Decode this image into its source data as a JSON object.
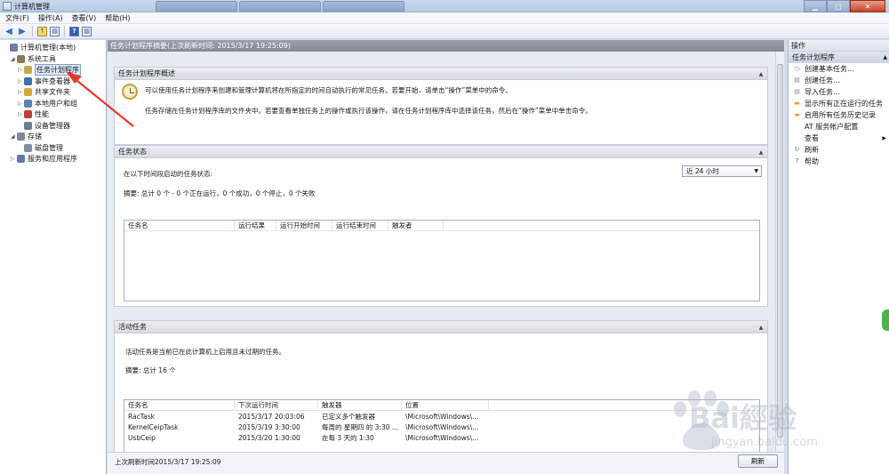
{
  "window": {
    "title": "计算机管理"
  },
  "menu": [
    "文件(F)",
    "操作(A)",
    "查看(V)",
    "帮助(H)"
  ],
  "tree": [
    {
      "label": "计算机管理(本地)",
      "level": 0,
      "expander": "",
      "icon_color": "#6a7fa0"
    },
    {
      "label": "系统工具",
      "level": 1,
      "expander": "◢",
      "icon_color": "#8a7a5a"
    },
    {
      "label": "任务计划程序",
      "level": 2,
      "expander": "▷",
      "icon_color": "#c8a848",
      "selected": true
    },
    {
      "label": "事件查看器",
      "level": 2,
      "expander": "▷",
      "icon_color": "#3f6fb0"
    },
    {
      "label": "共享文件夹",
      "level": 2,
      "expander": "▷",
      "icon_color": "#d4a640"
    },
    {
      "label": "本地用户和组",
      "level": 2,
      "expander": "▷",
      "icon_color": "#5a80b8"
    },
    {
      "label": "性能",
      "level": 2,
      "expander": "▷",
      "icon_color": "#c23a3a"
    },
    {
      "label": "设备管理器",
      "level": 2,
      "expander": "",
      "icon_color": "#6b7c90"
    },
    {
      "label": "存储",
      "level": 1,
      "expander": "◢",
      "icon_color": "#7a8a9a"
    },
    {
      "label": "磁盘管理",
      "level": 2,
      "expander": "",
      "icon_color": "#7f8fa3"
    },
    {
      "label": "服务和应用程序",
      "level": 1,
      "expander": "▷",
      "icon_color": "#5d7aa8"
    }
  ],
  "center": {
    "header": "任务计划程序摘要(上次刷新时间: 2015/3/17 19:25:09)",
    "overview": {
      "title": "任务计划程序概述",
      "line1": "可以使用任务计划程序来创建和管理计算机将在所指定的时间自动执行的常见任务。若要开始，请单击“操作”菜单中的命令。",
      "line2": "任务存储在任务计划程序库的文件夹中。若要查看单独任务上的操作或执行该操作，请在任务计划程序库中选择该任务，然后在“操作”菜单中单击命令。"
    },
    "status": {
      "title": "任务状态",
      "prompt": "在以下时间段启动的任务状态:",
      "range": "近 24 小时",
      "summary": "摘要: 总计 0 个 - 0 个正在运行，0 个成功，0 个停止，0 个失败",
      "columns": [
        "任务名",
        "运行结果",
        "运行开始时间",
        "运行结束时间",
        "触发者"
      ]
    },
    "active": {
      "title": "活动任务",
      "desc": "活动任务是当前已在此计算机上启用且未过期的任务。",
      "summary": "摘要: 总计 16 个",
      "columns": [
        "任务名",
        "下次运行时间",
        "触发器",
        "位置"
      ],
      "rows": [
        [
          "RacTask",
          "2015/3/17 20:03:06",
          "已定义多个触发器",
          "\\Microsoft\\Windows\\..."
        ],
        [
          "KernelCeipTask",
          "2015/3/19 3:30:00",
          "每周的 星期四 的 3:30 ...",
          "\\Microsoft\\Windows\\..."
        ],
        [
          "UsbCeip",
          "2015/3/20 1:30:00",
          "在每 3 天的 1:30",
          "\\Microsoft\\Windows\\..."
        ]
      ]
    },
    "footer": {
      "last_refresh": "上次刷新时间2015/3/17 19:25:09",
      "refresh": "刷新"
    }
  },
  "actions": {
    "header": "操作",
    "section": "任务计划程序",
    "items": [
      {
        "label": "创建基本任务...",
        "icon": "basic-task-icon",
        "color": "#8a95a8",
        "glyph": "◷"
      },
      {
        "label": "创建任务...",
        "icon": "create-task-icon",
        "color": "#7b8799",
        "glyph": "▤"
      },
      {
        "label": "导入任务...",
        "icon": "import-task-icon",
        "color": "#7b8799",
        "glyph": "▤"
      },
      {
        "label": "显示所有正在运行的任务",
        "icon": "running-tasks-icon",
        "color": "#d9a836",
        "glyph": "▬"
      },
      {
        "label": "启用所有任务历史记录",
        "icon": "history-icon",
        "color": "#d9a836",
        "glyph": "▬"
      },
      {
        "label": "AT 服务帐户配置",
        "icon": "",
        "color": "",
        "glyph": ""
      },
      {
        "label": "查看",
        "icon": "",
        "color": "",
        "glyph": "",
        "submenu": true
      },
      {
        "label": "刷新",
        "icon": "refresh-icon",
        "color": "#3a9a3a",
        "glyph": "↻"
      },
      {
        "label": "帮助",
        "icon": "help-icon",
        "color": "#2f5fb8",
        "glyph": "?"
      }
    ]
  },
  "watermark": {
    "text": "Bai經验",
    "sub": "jingyan.baidu.com"
  },
  "colors": {
    "annotation_arrow": "#e23b2e",
    "header_gray": "#8d949e"
  }
}
